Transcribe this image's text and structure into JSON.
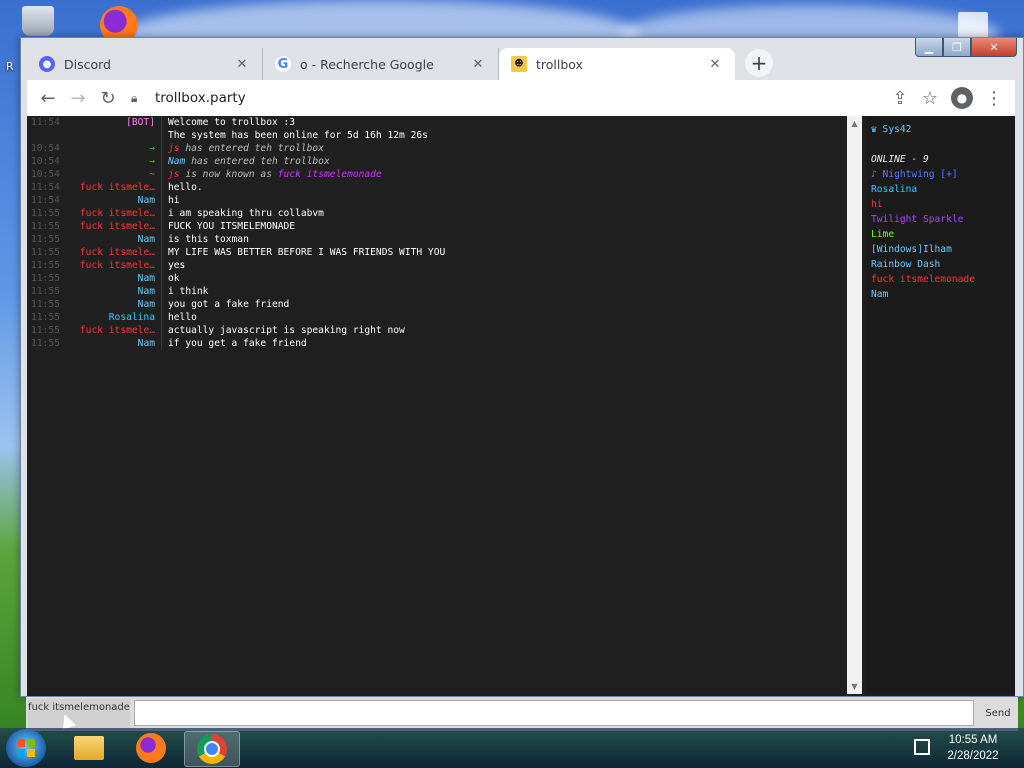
{
  "desktop": {
    "edge_label": "R"
  },
  "browser": {
    "tabs": [
      {
        "title": "Discord",
        "icon": "discord-icon"
      },
      {
        "title": "o - Recherche Google",
        "icon": "google-icon"
      },
      {
        "title": "trollbox",
        "icon": "trollbox-icon",
        "active": true
      }
    ],
    "address": "trollbox.party"
  },
  "chat": {
    "messages": [
      {
        "time": "11:54",
        "nick": "[BOT]",
        "nick_color": "#ff7eff",
        "text": "Welcome to trollbox :3"
      },
      {
        "time": "",
        "nick": "",
        "nick_color": "#ffffff",
        "text": "The system has been online for 5d 16h 12m 26s"
      },
      {
        "time": "10:54",
        "nick": "→",
        "nick_color": "#33cc33",
        "text": "",
        "segments": [
          {
            "text": "js",
            "color": "#ff3333"
          },
          {
            "text": " has entered teh trollbox",
            "color": "#bbbbbb"
          }
        ],
        "italic": true
      },
      {
        "time": "10:54",
        "nick": "→",
        "nick_color": "#33cc33",
        "text": "",
        "segments": [
          {
            "text": "Nam",
            "color": "#66ccff"
          },
          {
            "text": " has entered teh trollbox",
            "color": "#bbbbbb"
          }
        ],
        "italic": true
      },
      {
        "time": "10:54",
        "nick": "~",
        "nick_color": "#888888",
        "text": "",
        "segments": [
          {
            "text": "js",
            "color": "#ff3333"
          },
          {
            "text": " is now known as ",
            "color": "#bbbbbb"
          },
          {
            "text": "fuck itsmelemonade",
            "color": "#cc33ff"
          }
        ],
        "italic": true
      },
      {
        "time": "11:54",
        "nick": "fuck itsmele…",
        "nick_color": "#ff3333",
        "text": "hello."
      },
      {
        "time": "11:54",
        "nick": "Nam",
        "nick_color": "#66ccff",
        "text": "hi"
      },
      {
        "time": "11:55",
        "nick": "fuck itsmele…",
        "nick_color": "#ff3333",
        "text": "i am speaking thru collabvm"
      },
      {
        "time": "11:55",
        "nick": "fuck itsmele…",
        "nick_color": "#ff3333",
        "text": "FUCK YOU ITSMELEMONADE"
      },
      {
        "time": "11:55",
        "nick": "Nam",
        "nick_color": "#66ccff",
        "text": "is this toxman"
      },
      {
        "time": "11:55",
        "nick": "fuck itsmele…",
        "nick_color": "#ff3333",
        "text": "MY LIFE WAS BETTER BEFORE I WAS FRIENDS WITH YOU"
      },
      {
        "time": "11:55",
        "nick": "fuck itsmele…",
        "nick_color": "#ff3333",
        "text": "yes"
      },
      {
        "time": "11:55",
        "nick": "Nam",
        "nick_color": "#66ccff",
        "text": "ok"
      },
      {
        "time": "11:55",
        "nick": "Nam",
        "nick_color": "#66ccff",
        "text": "i think"
      },
      {
        "time": "11:55",
        "nick": "Nam",
        "nick_color": "#66ccff",
        "text": "you got a fake friend"
      },
      {
        "time": "11:55",
        "nick": "Rosalina",
        "nick_color": "#33ccff",
        "text": "hello"
      },
      {
        "time": "11:55",
        "nick": "fuck itsmele…",
        "nick_color": "#ff3333",
        "text": "actually javascript is speaking right now"
      },
      {
        "time": "11:55",
        "nick": "Nam",
        "nick_color": "#66ccff",
        "text": "if you get a fake friend"
      }
    ]
  },
  "userlist": {
    "top_user": {
      "name": "♛ Sys42",
      "color": "#66ccff"
    },
    "header": "ONLINE - 9",
    "users": [
      {
        "name": "♪ Nightwing [+]",
        "color": "#5577ff"
      },
      {
        "name": "Rosalina",
        "color": "#33ccff"
      },
      {
        "name": "hi",
        "color": "#ff3333"
      },
      {
        "name": "Twilight Sparkle",
        "color": "#aa44ff"
      },
      {
        "name": "Lime",
        "color": "#66ff33"
      },
      {
        "name": "[Windows]Ilham",
        "color": "#66ccff"
      },
      {
        "name": "Rainbow Dash",
        "color": "#66ccff"
      },
      {
        "name": "fuck itsmelemonade",
        "color": "#ff3333"
      },
      {
        "name": "Nam",
        "color": "#66ccff"
      }
    ]
  },
  "input": {
    "nick_label": "fuck itsmelemonade",
    "send_label": "Send",
    "message_value": ""
  },
  "taskbar": {
    "time": "10:55 AM",
    "date": "2/28/2022"
  }
}
